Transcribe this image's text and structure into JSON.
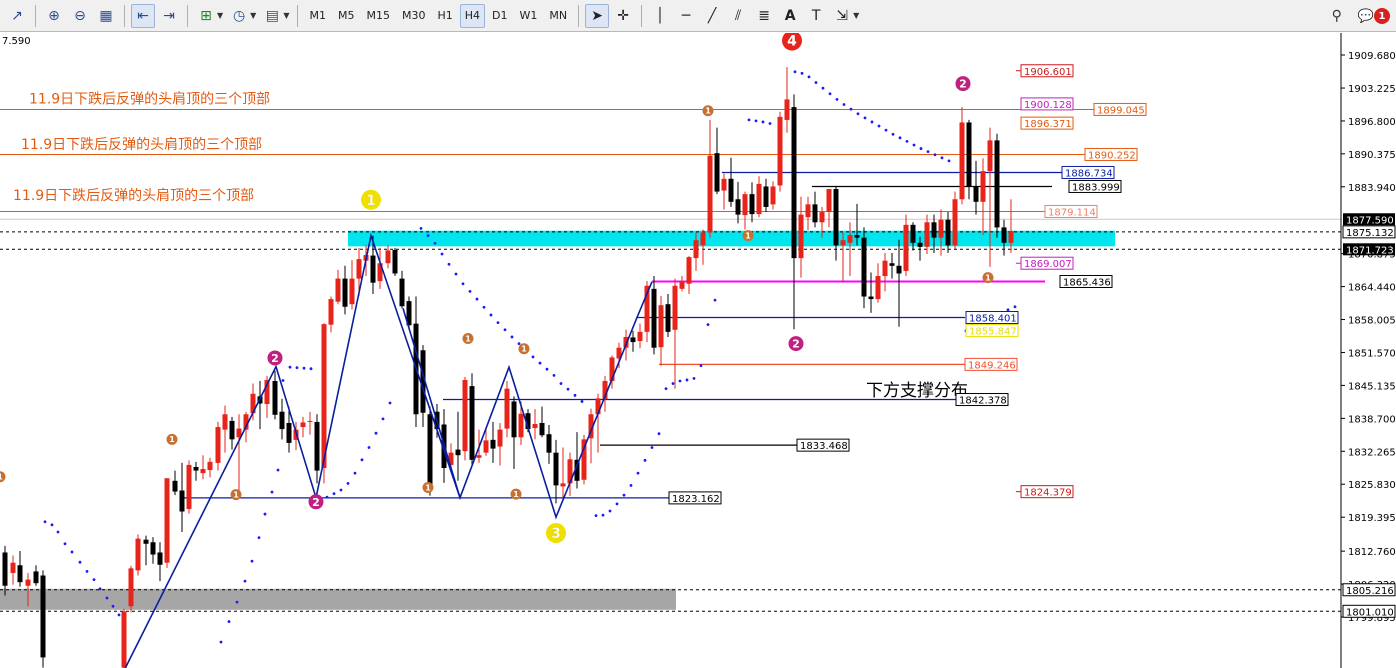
{
  "toolbar": {
    "timeframes": [
      "M1",
      "M5",
      "M15",
      "M30",
      "H1",
      "H4",
      "D1",
      "W1",
      "MN"
    ],
    "active_timeframe": "H4",
    "notification_count": "1"
  },
  "chart": {
    "corner_price": "7.590",
    "annotation_text": "11.9日下跌后反弹的头肩顶的三个顶部",
    "support_text": "下方支撑分布",
    "colors": {
      "bull": "#e8231a",
      "bear": "#000000",
      "trend": "#0a1ea0",
      "zone": "#00e5ee",
      "orange": "#e35b12",
      "magenta": "#ff00ff",
      "psar": "#1a1aff"
    },
    "price_axis": [
      {
        "price": 1909.68,
        "label": "1909.680"
      },
      {
        "price": 1903.225,
        "label": "1903.225"
      },
      {
        "price": 1896.8,
        "label": "1896.800"
      },
      {
        "price": 1890.375,
        "label": "1890.375"
      },
      {
        "price": 1883.94,
        "label": "1883.940"
      },
      {
        "price": 1870.875,
        "label": "1870.875"
      },
      {
        "price": 1864.44,
        "label": "1864.440"
      },
      {
        "price": 1858.005,
        "label": "1858.005"
      },
      {
        "price": 1851.57,
        "label": "1851.570"
      },
      {
        "price": 1845.135,
        "label": "1845.135"
      },
      {
        "price": 1838.7,
        "label": "1838.700"
      },
      {
        "price": 1832.265,
        "label": "1832.265"
      },
      {
        "price": 1825.83,
        "label": "1825.830"
      },
      {
        "price": 1819.395,
        "label": "1819.395"
      },
      {
        "price": 1812.76,
        "label": "1812.760"
      },
      {
        "price": 1806.32,
        "label": "1806.320"
      },
      {
        "price": 1799.895,
        "label": "1799.895"
      }
    ],
    "axis_highlight_labels": [
      {
        "price": 1877.59,
        "label": "1877.590",
        "style": "dark"
      },
      {
        "price": 1875.132,
        "label": "1875.132",
        "style": "box"
      },
      {
        "price": 1871.723,
        "label": "1871.723",
        "style": "dark"
      },
      {
        "price": 1805.216,
        "label": "1805.216",
        "style": "box"
      },
      {
        "price": 1801.01,
        "label": "1801.010",
        "style": "box"
      }
    ],
    "levels": [
      {
        "price": 1906.601,
        "label": "1906.601",
        "color": "#cc1a1a"
      },
      {
        "price": 1900.128,
        "label": "1900.128",
        "color": "#c020c0"
      },
      {
        "price": 1899.045,
        "label": "1899.045",
        "color": "#e35b12"
      },
      {
        "price": 1896.371,
        "label": "1896.371",
        "color": "#e35b12"
      },
      {
        "price": 1890.252,
        "label": "1890.252",
        "color": "#e35b12"
      },
      {
        "price": 1886.734,
        "label": "1886.734",
        "color": "#0a1ea0"
      },
      {
        "price": 1883.999,
        "label": "1883.999",
        "color": "#000000"
      },
      {
        "price": 1879.114,
        "label": "1879.114",
        "color": "#f08060"
      },
      {
        "price": 1869.007,
        "label": "1869.007",
        "color": "#c020c0"
      },
      {
        "price": 1865.436,
        "label": "1865.436",
        "color": "#000000"
      },
      {
        "price": 1858.401,
        "label": "1858.401",
        "color": "#0a1ea0"
      },
      {
        "price": 1855.847,
        "label": "1855.847",
        "color": "#e8e000"
      },
      {
        "price": 1849.246,
        "label": "1849.246",
        "color": "#f05030"
      },
      {
        "price": 1842.378,
        "label": "1842.378",
        "color": "#000000"
      },
      {
        "price": 1833.468,
        "label": "1833.468",
        "color": "#000000"
      },
      {
        "price": 1824.379,
        "label": "1824.379",
        "color": "#cc1a1a"
      },
      {
        "price": 1823.162,
        "label": "1823.162",
        "color": "#000000"
      }
    ],
    "markers": [
      {
        "text": "4",
        "color": "#e8231a",
        "size": "big",
        "price": 1912.5,
        "bar": 792
      },
      {
        "text": "1",
        "color": "#f0e000",
        "size": "big",
        "price": 1881.4,
        "bar": 371
      },
      {
        "text": "3",
        "color": "#f0e000",
        "size": "big",
        "price": 1816.3,
        "bar": 556
      },
      {
        "text": "2",
        "color": "#c02080",
        "size": "med",
        "price": 1850.5,
        "bar": 275
      },
      {
        "text": "2",
        "color": "#c02080",
        "size": "med",
        "price": 1822.4,
        "bar": 316
      },
      {
        "text": "2",
        "color": "#c02080",
        "size": "med",
        "price": 1853.3,
        "bar": 796
      },
      {
        "text": "2",
        "color": "#c02080",
        "size": "med",
        "price": 1904.1,
        "bar": 963
      },
      {
        "text": "1",
        "color": "#c87030",
        "size": "small",
        "price": 1834.6,
        "bar": 172
      },
      {
        "text": "1",
        "color": "#c87030",
        "size": "small",
        "price": 1823.8,
        "bar": 236
      },
      {
        "text": "1",
        "color": "#c87030",
        "size": "small",
        "price": 1825.2,
        "bar": 428
      },
      {
        "text": "1",
        "color": "#c87030",
        "size": "small",
        "price": 1854.3,
        "bar": 468
      },
      {
        "text": "1",
        "color": "#c87030",
        "size": "small",
        "price": 1852.3,
        "bar": 524
      },
      {
        "text": "1",
        "color": "#c87030",
        "size": "small",
        "price": 1823.9,
        "bar": 516
      },
      {
        "text": "1",
        "color": "#c87030",
        "size": "small",
        "price": 1898.8,
        "bar": 708
      },
      {
        "text": "1",
        "color": "#c87030",
        "size": "small",
        "price": 1874.4,
        "bar": 748
      },
      {
        "text": "1",
        "color": "#c87030",
        "size": "small",
        "price": 1866.2,
        "bar": 988
      },
      {
        "text": "1",
        "color": "#c87030",
        "size": "small",
        "price": 1827.3,
        "bar": 0
      }
    ]
  }
}
